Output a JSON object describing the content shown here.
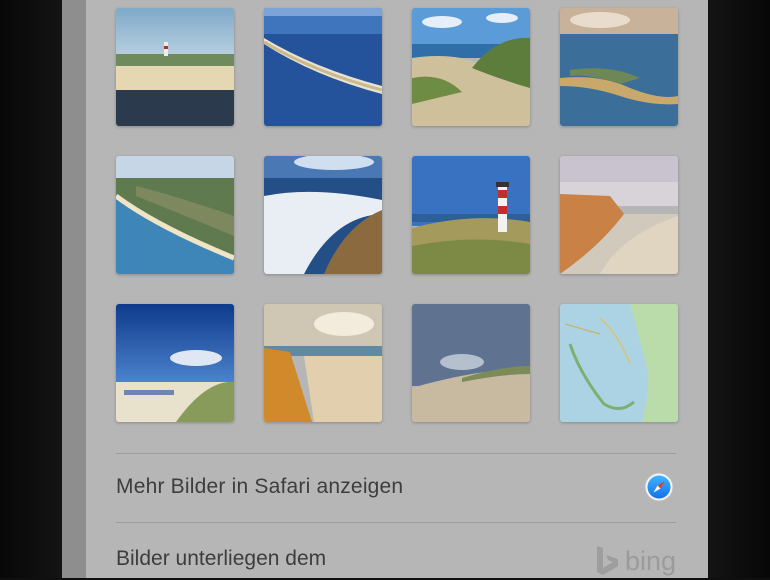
{
  "images": [
    {
      "name": "thumb-lighthouse-dunes-beach"
    },
    {
      "name": "thumb-aerial-sandbar"
    },
    {
      "name": "thumb-dunes-grass"
    },
    {
      "name": "thumb-aerial-island-tip"
    },
    {
      "name": "thumb-aerial-coastline"
    },
    {
      "name": "thumb-waves-beach"
    },
    {
      "name": "thumb-red-white-lighthouse"
    },
    {
      "name": "thumb-cliff-beach"
    },
    {
      "name": "thumb-beach-chairs-dunes"
    },
    {
      "name": "thumb-red-cliff-sunset"
    },
    {
      "name": "thumb-dune-cloudy-sky"
    },
    {
      "name": "thumb-island-map"
    }
  ],
  "more_images": {
    "label": "Mehr Bilder in Safari anzeigen",
    "icon": "safari-compass-icon"
  },
  "license": {
    "text": "Bilder unterliegen dem",
    "logo_text": "bing",
    "logo_icon": "bing-logo-icon"
  },
  "colors": {
    "panel_bg": "#b6b6b6",
    "text": "#3d3d3d",
    "safari_blue": "#1a8cf0"
  }
}
